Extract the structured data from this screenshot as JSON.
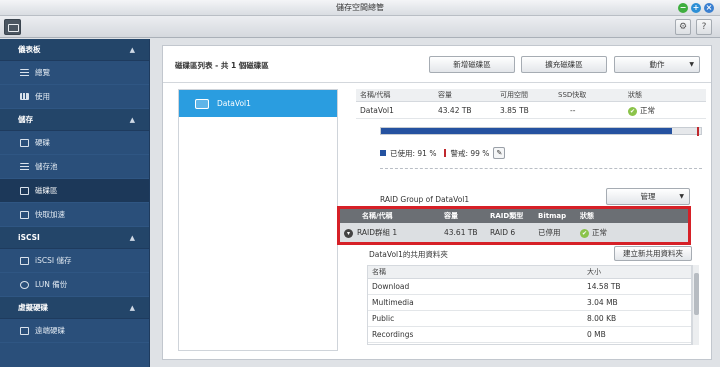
{
  "window": {
    "title": "儲存空間總管"
  },
  "toolbar": {
    "gear_glyph": "⚙",
    "help_glyph": "?"
  },
  "sidebar": {
    "sections": [
      {
        "label": "儀表板",
        "items": [
          {
            "label": "總覽"
          },
          {
            "label": "使用"
          }
        ]
      },
      {
        "label": "儲存",
        "items": [
          {
            "label": "硬碟"
          },
          {
            "label": "儲存池"
          },
          {
            "label": "磁碟區"
          },
          {
            "label": "快取加速"
          }
        ]
      },
      {
        "label": "iSCSI",
        "items": [
          {
            "label": "iSCSI 儲存"
          },
          {
            "label": "LUN 備份"
          }
        ]
      },
      {
        "label": "虛擬硬碟",
        "items": [
          {
            "label": "遠端硬碟"
          }
        ]
      }
    ]
  },
  "main": {
    "title": "磁碟區列表 - 共 1 個磁碟區",
    "buttons": {
      "new": "新增磁碟區",
      "expand": "擴充磁碟區",
      "action": "動作"
    },
    "volumes": [
      {
        "name": "DataVol1"
      }
    ],
    "info_table": {
      "headers": [
        "名稱/代稱",
        "容量",
        "可用空間",
        "SSD快取",
        "狀態"
      ],
      "row": {
        "name": "DataVol1",
        "capacity": "43.42 TB",
        "free": "3.85 TB",
        "ssd": "--",
        "status": "正常"
      }
    },
    "usage": {
      "used_label": "已使用: 91 %",
      "warn_label": "警戒: 99 %",
      "used_fraction": 0.91,
      "warn_fraction": 0.99
    },
    "raid": {
      "title": "RAID Group of DataVol1",
      "manage_button": "管理",
      "headers": [
        "名稱/代稱",
        "容量",
        "RAID類型",
        "Bitmap",
        "狀態"
      ],
      "row": {
        "name": "RAID群組 1",
        "capacity": "43.61 TB",
        "type": "RAID 6",
        "bitmap": "已停用",
        "status": "正常"
      }
    },
    "shares": {
      "title": "DataVol1的共用資料夾",
      "new_button": "建立新共用資料夾",
      "headers": [
        "名稱",
        "大小"
      ],
      "rows": [
        {
          "name": "Download",
          "size": "14.58 TB"
        },
        {
          "name": "Multimedia",
          "size": "3.04 MB"
        },
        {
          "name": "Public",
          "size": "8.00 KB"
        },
        {
          "name": "Recordings",
          "size": "0 MB"
        }
      ]
    }
  },
  "colors": {
    "sidebar": "#2a4f7a",
    "selected": "#2a9de0",
    "used": "#2552a0",
    "warn": "#c0282d",
    "highlight": "#d62027"
  }
}
